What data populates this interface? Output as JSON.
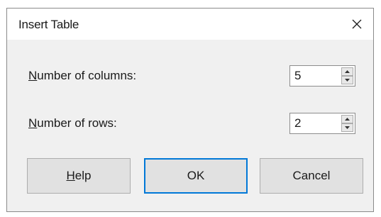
{
  "dialog": {
    "title": "Insert Table",
    "close_icon": "close-icon"
  },
  "columns": {
    "label_mnemonic": "N",
    "label_rest": "umber of columns:",
    "value": "5"
  },
  "rows": {
    "label_mnemonic": "N",
    "label_rest": "umber of rows:",
    "value": "2"
  },
  "buttons": {
    "help_mnemonic": "H",
    "help_rest": "elp",
    "ok": "OK",
    "cancel": "Cancel"
  },
  "colors": {
    "dialog_bg": "#f0f0f0",
    "titlebar_bg": "#ffffff",
    "default_button_border": "#0078d7"
  }
}
